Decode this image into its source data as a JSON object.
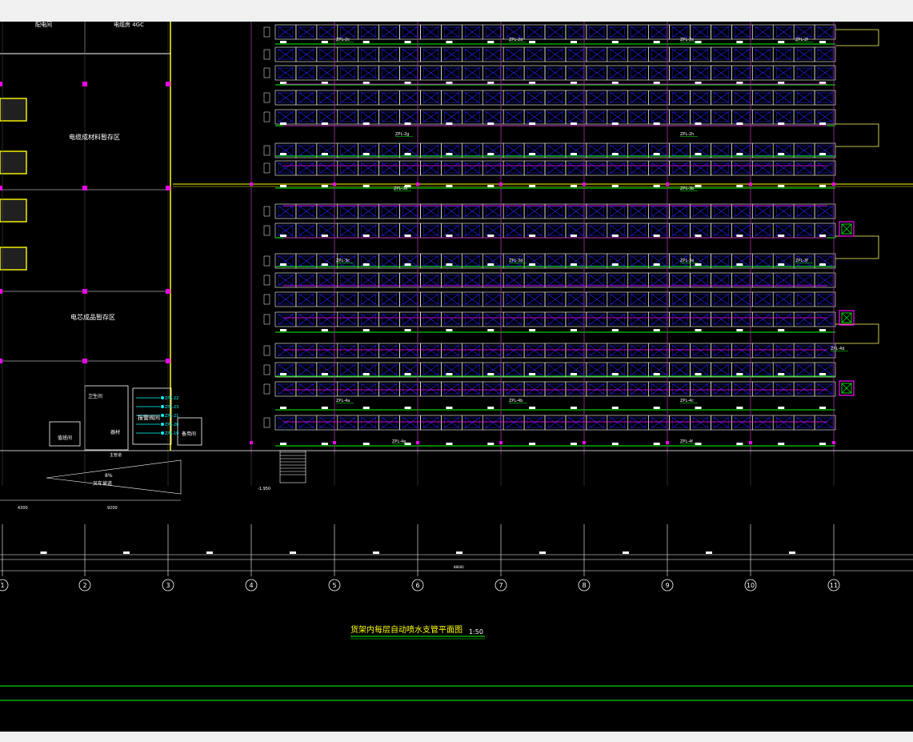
{
  "drawing": {
    "title": "货架内每层自动喷水支管平面图",
    "scale": "1:50",
    "rooms": {
      "top_left_a": "配电间",
      "top_left_b": "电缆房 4GC",
      "storage_a": "电缆成材料暂存区",
      "storage_b": "电芯成品暂存区",
      "toilet": "卫生间",
      "duty": "值班间",
      "alarm_valve": "报警阀间",
      "shower": "更衣",
      "equipment": "器材",
      "spare": "备用间",
      "main_pipe": "主管道",
      "ramp": "叉车坡道",
      "slope": "8%",
      "elev_mark": "-1.950"
    },
    "pipe_labels": [
      "ZPL-2c",
      "ZPL-2d",
      "ZPL-2e",
      "ZPL-2f",
      "ZPL-2g",
      "ZPL-2h",
      "ZPL-3a",
      "ZPL-3b",
      "ZPL-3c",
      "ZPL-3d",
      "ZPL-3e",
      "ZPL-3f",
      "ZPL-4d",
      "ZPL-4a",
      "ZPL-4b",
      "ZPL-4c",
      "ZPL-4e",
      "ZPL-4f"
    ],
    "riser_labels": [
      "ZPL-22",
      "ZPL-23",
      "ZPL-21",
      "ZPL-20",
      "ZPL-19"
    ],
    "dim_values": [
      "4300",
      "9200"
    ],
    "total_dim": "88600",
    "axes": [
      "1",
      "2",
      "3",
      "4",
      "5",
      "6",
      "7",
      "8",
      "9",
      "10",
      "11"
    ]
  },
  "colors": {
    "background": "#000000",
    "rack": "#ffffff",
    "rack_cross": "#2222ff",
    "branch_pipe": "#00ff00",
    "main_pipe": "#ff00ff",
    "wall": "#ffff00",
    "axis": "#ffffff",
    "riser": "#00ffff"
  }
}
